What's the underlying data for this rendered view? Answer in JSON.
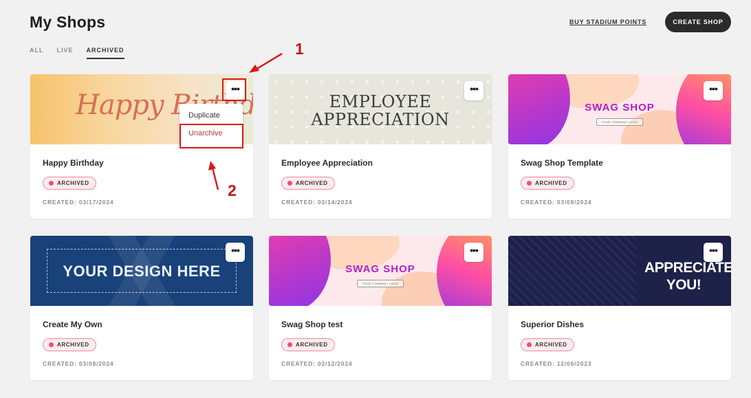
{
  "header": {
    "title": "My Shops",
    "buy_link": "BUY STADIUM POINTS",
    "create_button": "CREATE SHOP"
  },
  "tabs": [
    {
      "label": "ALL",
      "active": false
    },
    {
      "label": "LIVE",
      "active": false
    },
    {
      "label": "ARCHIVED",
      "active": true
    }
  ],
  "cards": [
    {
      "name": "Happy Birthday",
      "status": "ARCHIVED",
      "created": "CREATED: 03/17/2024",
      "banner_text": "Happy Birthd"
    },
    {
      "name": "Employee Appreciation",
      "status": "ARCHIVED",
      "created": "CREATED: 03/14/2024",
      "banner_line1": "EMPLOYEE",
      "banner_line2": "APPRECIATION"
    },
    {
      "name": "Swag Shop Template",
      "status": "ARCHIVED",
      "created": "CREATED: 03/08/2024",
      "banner_text": "SWAG SHOP",
      "banner_logo": "YOUR COMPANY LOGO"
    },
    {
      "name": "Create My Own",
      "status": "ARCHIVED",
      "created": "CREATED: 03/08/2024",
      "banner_text": "YOUR DESIGN HERE"
    },
    {
      "name": "Swag Shop test",
      "status": "ARCHIVED",
      "created": "CREATED: 02/12/2024",
      "banner_text": "SWAG SHOP",
      "banner_logo": "YOUR COMPANY LOGO"
    },
    {
      "name": "Superior Dishes",
      "status": "ARCHIVED",
      "created": "CREATED: 12/06/2023",
      "banner_line1": "APPRECIATE",
      "banner_line2": "YOU!"
    }
  ],
  "menu": {
    "duplicate": "Duplicate",
    "unarchive": "Unarchive"
  },
  "annotations": {
    "step1": "1",
    "step2": "2"
  },
  "colors": {
    "badge_dot": "#f0506a",
    "badge_border": "#f08a98",
    "annotation": "#d81a1a",
    "dark_button": "#2b2b2b"
  },
  "icons": {
    "more": "more-options-icon",
    "status_dot": "status-dot-icon",
    "arrow": "arrow-annotation-icon"
  }
}
